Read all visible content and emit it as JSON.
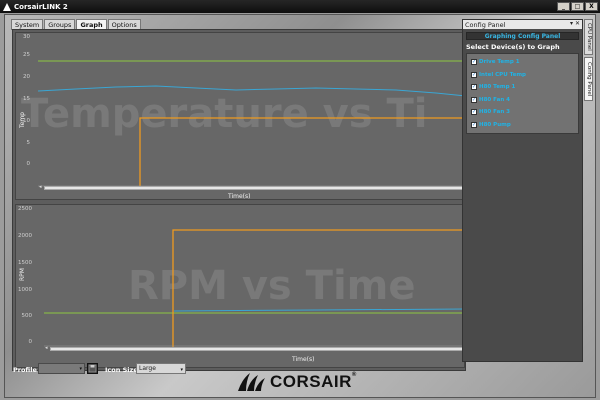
{
  "app": {
    "title": "CorsairLINK 2"
  },
  "window_buttons": [
    "_",
    "□",
    "X"
  ],
  "tabs": [
    {
      "label": "System",
      "active": false
    },
    {
      "label": "Groups",
      "active": false
    },
    {
      "label": "Graph",
      "active": true
    },
    {
      "label": "Options",
      "active": false
    }
  ],
  "temp_graph": {
    "watermark": "Temperature vs Ti",
    "ylabel": "Temp",
    "xlabel": "Time(s)",
    "ticks": [
      "30",
      "25",
      "20",
      "15",
      "10",
      "5",
      "0"
    ]
  },
  "rpm_graph": {
    "watermark": "RPM vs Time",
    "ylabel": "RPM",
    "xlabel": "Time(s)",
    "ticks": [
      "2500",
      "2000",
      "1500",
      "1000",
      "500",
      "0"
    ]
  },
  "config_panel": {
    "header": "Config Panel",
    "header_icons": "▾ ✕",
    "title": "Graphing Config Panel",
    "select_label": "Select Device(s) to Graph",
    "devices": [
      "Drive Temp 1",
      "Intel CPU Temp",
      "H80 Temp 1",
      "H80 Fan 4",
      "H80 Fan 3",
      "H80 Pump"
    ],
    "checkmark": "✓"
  },
  "side_tabs": [
    {
      "label": "CPU Panel",
      "active": false
    },
    {
      "label": "Config Panel",
      "active": true
    }
  ],
  "bottom": {
    "profile_label": "Profile :",
    "profile_value": "",
    "icon_size_label": "Icon Size :",
    "icon_size_value": "Large",
    "dropdown_glyph": "▾",
    "brand": "CORSAIR",
    "registered": "®"
  },
  "colors": {
    "accent": "#1fb3e6",
    "orange_series": "#ef9a1f",
    "green_series": "#8ec740",
    "blue_series": "#3aa6d4",
    "graph_bg": "#676767"
  }
}
